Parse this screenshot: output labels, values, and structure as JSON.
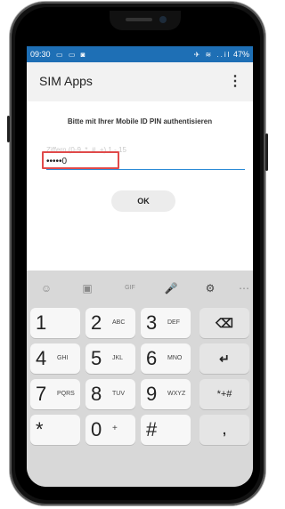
{
  "status_bar": {
    "time": "09:30",
    "left_icons": "▭ ▭ ◙",
    "right_icons": "✈ ≋ ..il",
    "battery": "47%"
  },
  "app": {
    "title": "SIM Apps",
    "menu_icon": "⋮"
  },
  "form": {
    "prompt": "Bitte mit Ihrer Mobile ID PIN authentisieren",
    "hint": "Ziffern (0-9, *, #, +) 1 - 15",
    "pin_value": "•••••0",
    "ok_label": "OK"
  },
  "keyboard": {
    "toolbar": [
      "emoji-icon",
      "sticker-icon",
      "gif-icon",
      "microphone-icon",
      "settings-icon",
      "more-icon"
    ],
    "keys": [
      {
        "digit": "1",
        "letters": ""
      },
      {
        "digit": "2",
        "letters": "ABC"
      },
      {
        "digit": "3",
        "letters": "DEF"
      },
      {
        "digit": "4",
        "letters": "GHI"
      },
      {
        "digit": "5",
        "letters": "JKL"
      },
      {
        "digit": "6",
        "letters": "MNO"
      },
      {
        "digit": "7",
        "letters": "PQRS"
      },
      {
        "digit": "8",
        "letters": "TUV"
      },
      {
        "digit": "9",
        "letters": "WXYZ"
      },
      {
        "digit": "*",
        "letters": ""
      },
      {
        "digit": "0",
        "letters": "+"
      },
      {
        "digit": "#",
        "letters": ""
      }
    ],
    "backspace_symbol": "⌫",
    "enter_symbol": "↵",
    "symbols_label": "*+#",
    "comma_label": ","
  }
}
